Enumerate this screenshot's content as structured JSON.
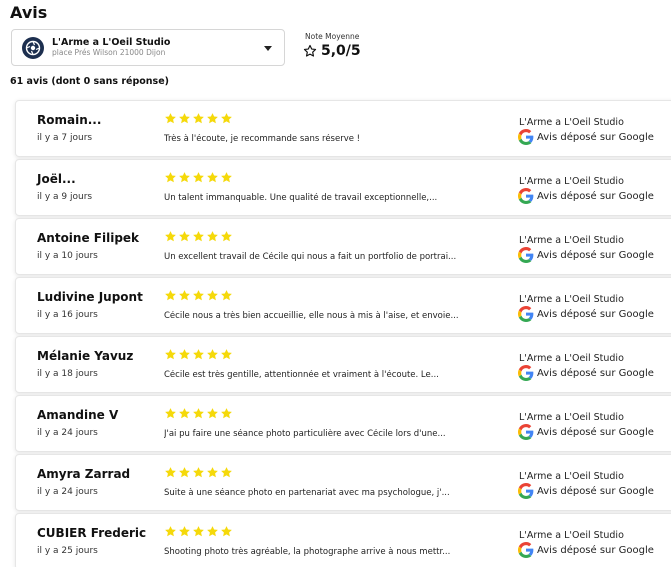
{
  "page": {
    "title": "Avis"
  },
  "studio_select": {
    "name": "L'Arme a L'Oeil Studio",
    "address": "place Prés Wilson 21000 Dijon"
  },
  "rating": {
    "label": "Note Moyenne",
    "value": "5,0/5",
    "stars_color": "#f5d90a"
  },
  "reviews_count": "61 avis (dont 0 sans réponse)",
  "reviews": [
    {
      "name": "Romain...",
      "date": "il y a 7 jours",
      "stars": 5,
      "text": "Très à l'écoute, je recommande sans réserve !",
      "studio": "L'Arme a L'Oeil Studio",
      "source": "Avis déposé sur Google"
    },
    {
      "name": "Joël...",
      "date": "il y a 9 jours",
      "stars": 5,
      "text": "Un talent immanquable. Une qualité de travail exceptionnelle,...",
      "studio": "L'Arme a L'Oeil Studio",
      "source": "Avis déposé sur Google"
    },
    {
      "name": "Antoine Filipek",
      "date": "il y a 10 jours",
      "stars": 5,
      "text": "Un excellent travail de Cécile qui nous a fait un portfolio de portrai...",
      "studio": "L'Arme a L'Oeil Studio",
      "source": "Avis déposé sur Google"
    },
    {
      "name": "Ludivine Jupont",
      "date": "il y a 16 jours",
      "stars": 5,
      "text": "Cécile nous a très bien accueillie, elle nous à mis à l'aise, et envoie...",
      "studio": "L'Arme a L'Oeil Studio",
      "source": "Avis déposé sur Google"
    },
    {
      "name": "Mélanie Yavuz",
      "date": "il y a 18 jours",
      "stars": 5,
      "text": "Cécile est très gentille, attentionnée et vraiment à l'écoute. Le...",
      "studio": "L'Arme a L'Oeil Studio",
      "source": "Avis déposé sur Google"
    },
    {
      "name": "Amandine V",
      "date": "il y a 24 jours",
      "stars": 5,
      "text": "J'ai pu faire une séance photo particulière avec Cécile lors d'une...",
      "studio": "L'Arme a L'Oeil Studio",
      "source": "Avis déposé sur Google"
    },
    {
      "name": "Amyra Zarrad",
      "date": "il y a 24 jours",
      "stars": 5,
      "text": "Suite à une séance photo en partenariat avec ma psychologue, j'...",
      "studio": "L'Arme a L'Oeil Studio",
      "source": "Avis déposé sur Google"
    },
    {
      "name": "CUBIER Frederic",
      "date": "il y a 25 jours",
      "stars": 5,
      "text": "Shooting photo très agréable, la photographe arrive à nous mettr...",
      "studio": "L'Arme a L'Oeil Studio",
      "source": "Avis déposé sur Google"
    }
  ]
}
